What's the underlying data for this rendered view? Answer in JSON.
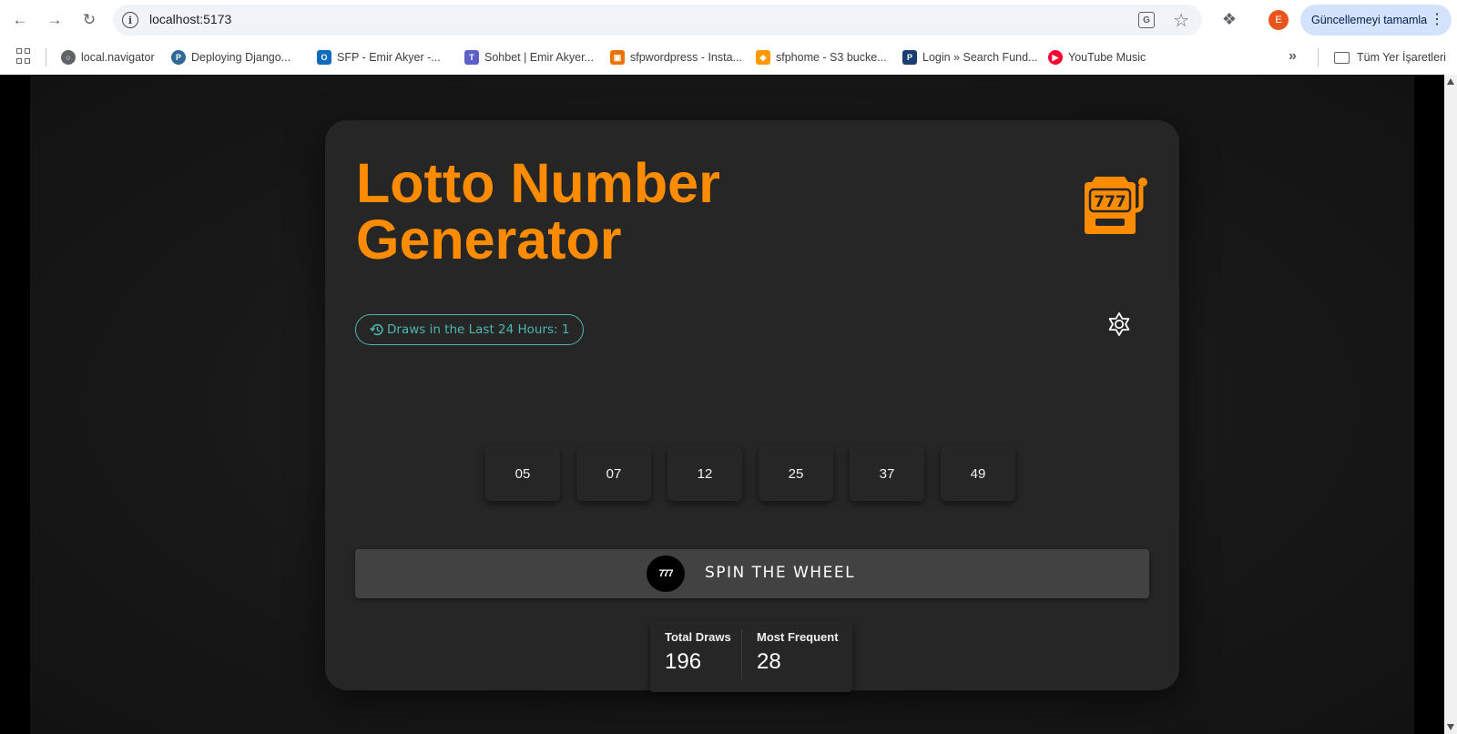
{
  "browser": {
    "url": "localhost:5173",
    "update_button_label": "Güncellemeyi tamamla",
    "avatar_letter": "E",
    "bookmarks": [
      {
        "label": "local.navigator",
        "color": "#5f6368"
      },
      {
        "label": "Deploying Django...",
        "color": "#306998"
      },
      {
        "label": "SFP - Emir Akyer -...",
        "color": "#0f6cbd"
      },
      {
        "label": "Sohbet | Emir Akyer...",
        "color": "#5b5fc7"
      },
      {
        "label": "sfpwordpress - Insta...",
        "color": "#ed7100"
      },
      {
        "label": "sfphome - S3 bucke...",
        "color": "#ff9900"
      },
      {
        "label": "Login » Search Fund...",
        "color": "#1a3e72"
      },
      {
        "label": "YouTube Music",
        "color": "#ff0033"
      }
    ],
    "all_bookmarks_label": "Tüm Yer İşaretleri"
  },
  "app": {
    "title_line1": "Lotto Number",
    "title_line2": "Generator",
    "draws_badge": "Draws in the Last 24 Hours: 1",
    "numbers": [
      "05",
      "07",
      "12",
      "25",
      "37",
      "49"
    ],
    "spin_label": "SPIN THE WHEEL",
    "spin_wheel_text": "777",
    "stats": {
      "total_draws_label": "Total Draws",
      "total_draws_value": "196",
      "most_frequent_label": "Most Frequent",
      "most_frequent_value": "28"
    },
    "accent_color": "#ff8c00",
    "badge_color": "#4db6ac"
  }
}
